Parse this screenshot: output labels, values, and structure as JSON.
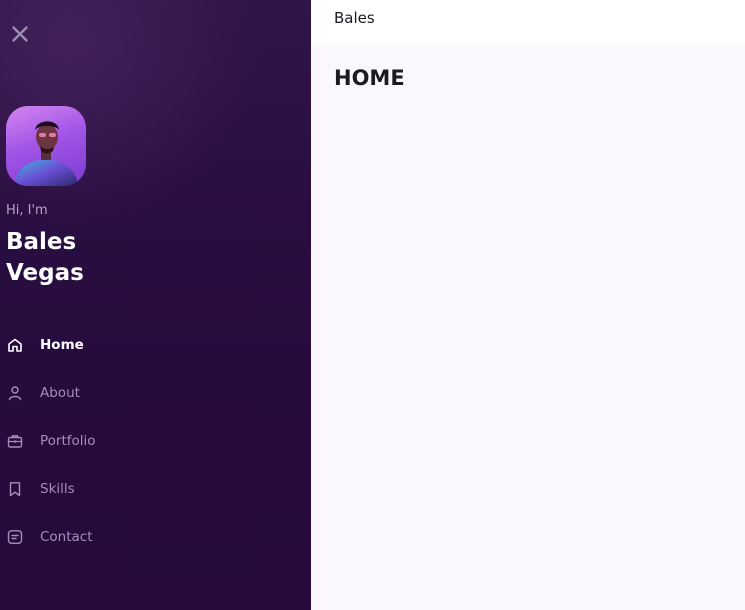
{
  "sidebar": {
    "close_icon": "close-icon",
    "avatar_alt": "profile photo",
    "greeting": "Hi, I'm",
    "first_name": "Bales",
    "last_name": "Vegas",
    "nav": [
      {
        "label": "Home",
        "icon": "home-icon",
        "active": true
      },
      {
        "label": "About",
        "icon": "user-icon",
        "active": false
      },
      {
        "label": "Portfolio",
        "icon": "briefcase-icon",
        "active": false
      },
      {
        "label": "Skills",
        "icon": "bookmark-icon",
        "active": false
      },
      {
        "label": "Contact",
        "icon": "message-icon",
        "active": false
      }
    ]
  },
  "header": {
    "brand": "Bales"
  },
  "main": {
    "title": "HOME"
  },
  "colors": {
    "sidebar_bg": "#260b3d",
    "nav_inactive": "#a58fb7",
    "nav_active": "#ffffff",
    "main_bg": "#faf7fd",
    "avatar_accent": "#a255e6"
  }
}
